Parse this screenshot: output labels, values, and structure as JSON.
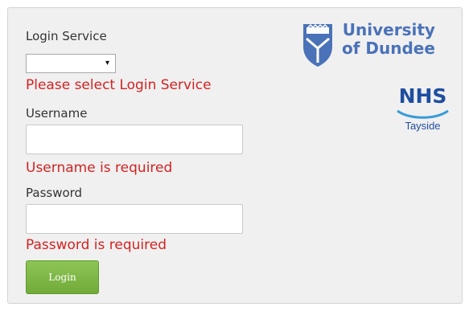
{
  "form": {
    "service_label": "Login Service",
    "service_value": "",
    "service_dropdown_arrow": "▾",
    "service_error": "Please select Login Service",
    "username_label": "Username",
    "username_value": "",
    "username_error": "Username is required",
    "password_label": "Password",
    "password_value": "",
    "password_error": "Password is required",
    "login_button": "Login"
  },
  "branding": {
    "university_line1": "University",
    "university_line2": "of Dundee",
    "university_color": "#4a72b8",
    "nhs_name": "NHS",
    "nhs_region": "Tayside",
    "nhs_color": "#1f4e9f"
  },
  "colors": {
    "error": "#d42222",
    "button": "#7db84a",
    "panel": "#f0f0f0"
  },
  "icons": {
    "dundee_crest": "university-crest-icon",
    "nhs_swoosh": "nhs-swoosh-icon"
  }
}
